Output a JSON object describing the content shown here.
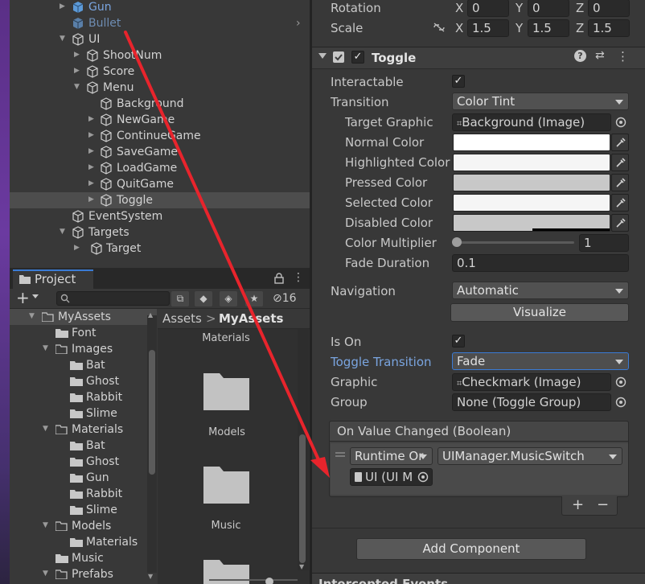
{
  "hierarchy": {
    "items": [
      {
        "label": "Gun"
      },
      {
        "label": "Bullet"
      },
      {
        "label": "UI"
      },
      {
        "label": "ShootNum"
      },
      {
        "label": "Score"
      },
      {
        "label": "Menu"
      },
      {
        "label": "Background"
      },
      {
        "label": "NewGame"
      },
      {
        "label": "ContinueGame"
      },
      {
        "label": "SaveGame"
      },
      {
        "label": "LoadGame"
      },
      {
        "label": "QuitGame"
      },
      {
        "label": "Toggle"
      },
      {
        "label": "EventSystem"
      },
      {
        "label": "Targets"
      },
      {
        "label": "Target"
      }
    ]
  },
  "project": {
    "tab_label": "Project",
    "add_label": "+",
    "hidden_count": "16",
    "tree": [
      {
        "label": "MyAssets"
      },
      {
        "label": "Font"
      },
      {
        "label": "Images"
      },
      {
        "label": "Bat"
      },
      {
        "label": "Ghost"
      },
      {
        "label": "Rabbit"
      },
      {
        "label": "Slime"
      },
      {
        "label": "Materials"
      },
      {
        "label": "Bat"
      },
      {
        "label": "Ghost"
      },
      {
        "label": "Gun"
      },
      {
        "label": "Rabbit"
      },
      {
        "label": "Slime"
      },
      {
        "label": "Models"
      },
      {
        "label": "Materials"
      },
      {
        "label": "Music"
      },
      {
        "label": "Prefabs"
      }
    ],
    "breadcrumb": {
      "root": "Assets",
      "sep": ">",
      "current": "MyAssets"
    },
    "grid": [
      {
        "label": "Materials"
      },
      {
        "label": "Models"
      },
      {
        "label": "Music"
      }
    ]
  },
  "inspector": {
    "transform": {
      "rotation_label": "Rotation",
      "rotation": {
        "x": "0",
        "y": "0",
        "z": "0"
      },
      "scale_label": "Scale",
      "scale": {
        "x": "1.5",
        "y": "1.5",
        "z": "1.5"
      },
      "axis": {
        "x": "X",
        "y": "Y",
        "z": "Z"
      }
    },
    "component_title": "Toggle",
    "fields": {
      "interactable": "Interactable",
      "transition": "Transition",
      "transition_value": "Color Tint",
      "target_graphic": "Target Graphic",
      "target_graphic_value": "Background (Image)",
      "normal_color": "Normal Color",
      "highlighted_color": "Highlighted Color",
      "pressed_color": "Pressed Color",
      "selected_color": "Selected Color",
      "disabled_color": "Disabled Color",
      "color_multiplier": "Color Multiplier",
      "color_multiplier_value": "1",
      "fade_duration": "Fade Duration",
      "fade_duration_value": "0.1",
      "navigation": "Navigation",
      "navigation_value": "Automatic",
      "visualize": "Visualize",
      "is_on": "Is On",
      "toggle_transition": "Toggle Transition",
      "toggle_transition_value": "Fade",
      "graphic": "Graphic",
      "graphic_value": "Checkmark (Image)",
      "group": "Group",
      "group_value": "None (Toggle Group)"
    },
    "colors": {
      "normal": "#ffffff",
      "highlighted": "#f5f5f5",
      "pressed": "#c8c8c8",
      "selected": "#f5f5f5",
      "disabled": "#c8c8c8"
    },
    "event": {
      "header": "On Value Changed (Boolean)",
      "runtime": "Runtime Or",
      "function": "UIManager.MusicSwitch",
      "target": "UI (UI M",
      "plus": "+",
      "minus": "−"
    },
    "add_component": "Add Component",
    "next_component": "Intercepted Events"
  },
  "accent_color": "#3a7bd5",
  "annotation_arrow_color": "#e8242c"
}
